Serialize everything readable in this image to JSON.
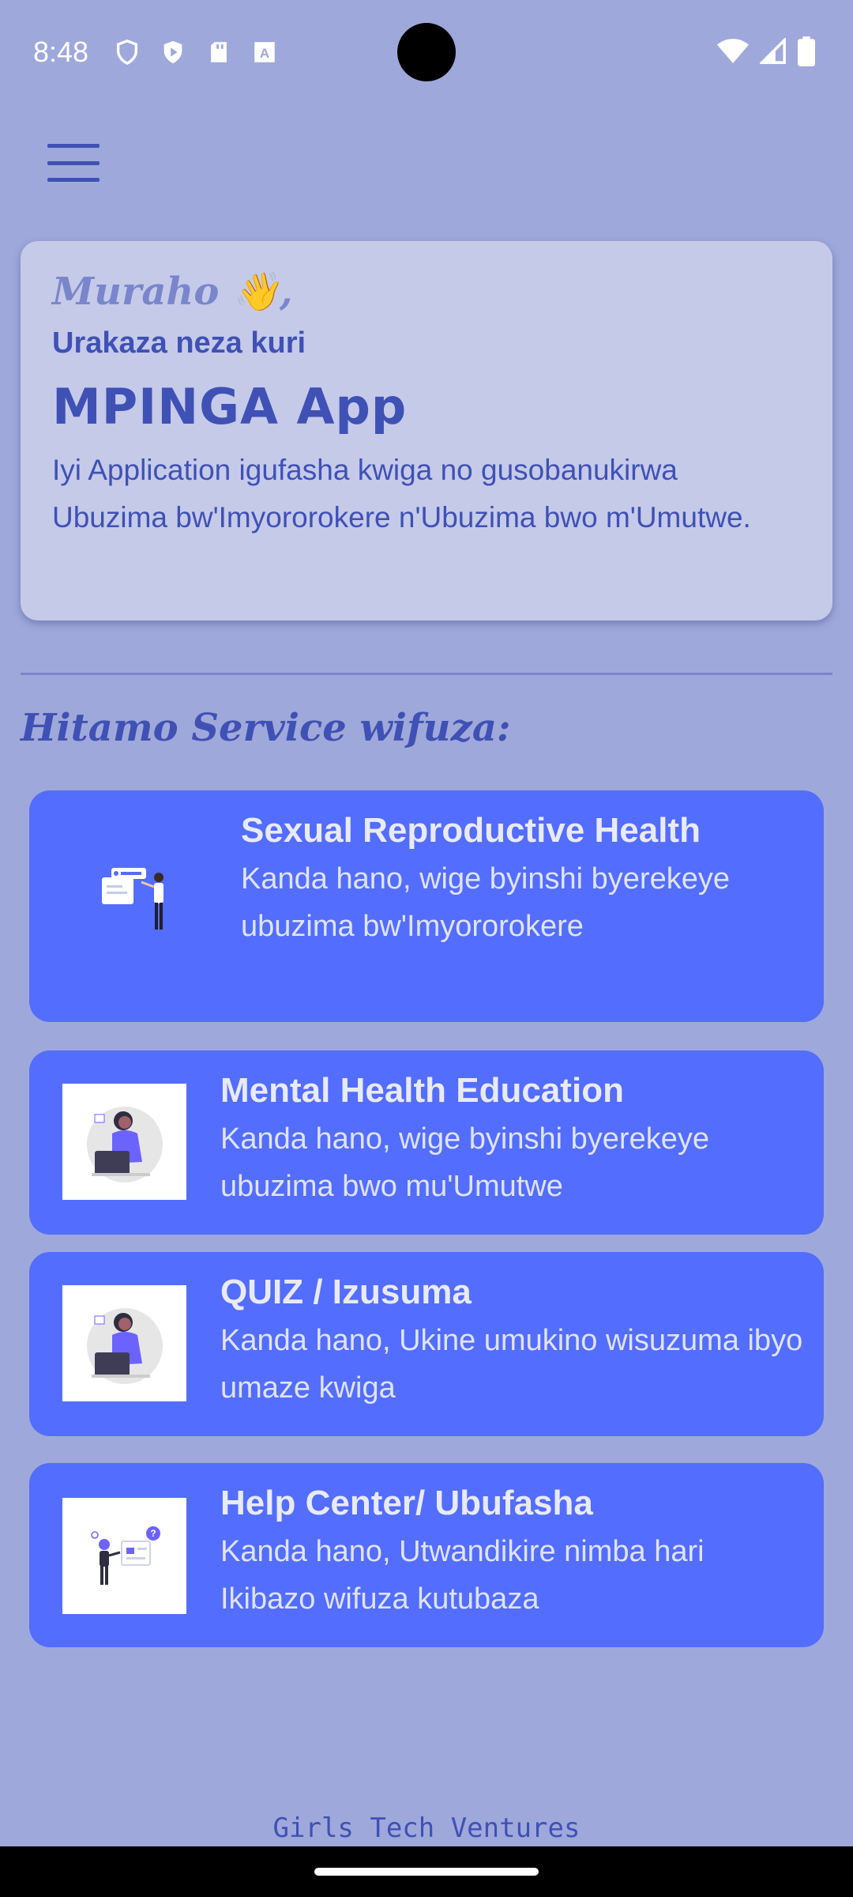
{
  "status_bar": {
    "time": "8:48",
    "icons": [
      "shield-icon",
      "play-protect-icon",
      "sd-card-icon",
      "keyboard-a-icon"
    ],
    "right_icons": [
      "wifi-icon",
      "signal-icon",
      "battery-icon"
    ]
  },
  "header": {
    "menu_icon": "hamburger-menu-icon"
  },
  "welcome": {
    "greeting": "Muraho 👋,",
    "subtitle": "Urakaza neza kuri",
    "app_name": "MPINGA App",
    "description": "Iyi Application igufasha kwiga no gusobanukirwa Ubuzima bw'Imyororokere n'Ubuzima bwo m'Umutwe."
  },
  "section": {
    "title": "Hitamo Service wifuza:"
  },
  "services": [
    {
      "title": "Sexual Reproductive Health",
      "description": "Kanda hano, wige byinshi byerekeye ubuzima bw'Imyororokere",
      "icon": "presentation-illustration-icon"
    },
    {
      "title": "Mental Health Education",
      "description": "Kanda hano, wige byinshi byerekeye ubuzima bwo mu'Umutwe",
      "icon": "woman-laptop-illustration-icon"
    },
    {
      "title": "QUIZ / Izusuma",
      "description": "Kanda hano, Ukine umukino wisuzuma ibyo umaze kwiga",
      "icon": "woman-laptop-illustration-icon"
    },
    {
      "title": "Help Center/ Ubufasha",
      "description": "Kanda hano, Utwandikire nimba hari Ikibazo wifuza kutubaza",
      "icon": "help-question-illustration-icon"
    }
  ],
  "footer": {
    "text": "Girls Tech Ventures"
  },
  "colors": {
    "background": "#9fa8da",
    "card": "#536dfe",
    "accent": "#3f51b5",
    "welcome_card": "#c5cae9"
  }
}
